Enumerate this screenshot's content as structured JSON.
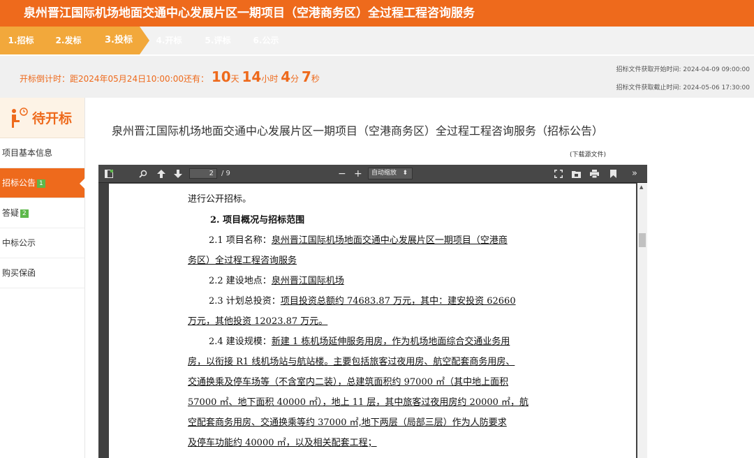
{
  "header": {
    "title": "泉州晋江国际机场地面交通中心发展片区一期项目（空港商务区）全过程工程咨询服务"
  },
  "steps": [
    "1.招标",
    "2.发标",
    "3.投标",
    "4.开标",
    "5.评标",
    "6.公示"
  ],
  "countdown": {
    "prefix": "开标倒计时：距2024年05月24日10:00:00还有：",
    "days": "10",
    "days_unit": "天",
    "hours": "14",
    "hours_unit": "小时",
    "minutes": "4",
    "minutes_unit": "分",
    "seconds": "7",
    "seconds_unit": "秒",
    "start_time": "招标文件获取开始时间: 2024-04-09 09:00:00",
    "end_time": "招标文件获取截止时间: 2024-05-06 17:30:00"
  },
  "sidebar": {
    "heading": "待开标",
    "items": [
      {
        "label": "项目基本信息",
        "badge": ""
      },
      {
        "label": "招标公告",
        "badge": "1"
      },
      {
        "label": "答疑",
        "badge": "2"
      },
      {
        "label": "中标公示",
        "badge": ""
      },
      {
        "label": "购买保函",
        "badge": ""
      }
    ]
  },
  "main": {
    "title": "泉州晋江国际机场地面交通中心发展片区一期项目（空港商务区）全过程工程咨询服务（招标公告）",
    "download": "(下载源文件)"
  },
  "pdf": {
    "page_current": "2",
    "page_total": "/ 9",
    "zoom": "自动缩放",
    "lines": [
      {
        "text": "进行公开招标。",
        "u": ""
      },
      {
        "text": "2. 项目概况与招标范围",
        "u": ""
      },
      {
        "text": "2.1 项目名称：",
        "u": "泉州晋江国际机场地面交通中心发展片区一期项目（空港商"
      },
      {
        "text": "",
        "u": "务区）全过程工程咨询服务"
      },
      {
        "text": "2.2 建设地点：",
        "u": "泉州晋江国际机场"
      },
      {
        "text": "2.3 计划总投资：",
        "u": "项目投资总额约 74683.87 万元，其中：建安投资 62660"
      },
      {
        "text": "",
        "u": "万元，其他投资 12023.87 万元。"
      },
      {
        "text": "2.4 建设规模：",
        "u": "新建 1 栋机场延伸服务用房，作为机场地面综合交通业务用"
      },
      {
        "text": "",
        "u": "房，以衔接 R1 线机场站与航站楼。主要包括旅客过夜用房、航空配套商务用房、"
      },
      {
        "text": "",
        "u": "交通换乘及停车场等（不含室内二装），总建筑面积约 97000 ㎡（其中地上面积"
      },
      {
        "text": "",
        "u": "57000 ㎡、地下面积 40000 ㎡），地上 11 层，其中旅客过夜用房约 20000 ㎡，航"
      },
      {
        "text": "",
        "u": "空配套商务用房、交通换乘等约 37000 ㎡,地下两层（局部三层）作为人防要求"
      },
      {
        "text": "",
        "u": "及停车功能约 40000 ㎡，以及相关配套工程；"
      }
    ]
  }
}
